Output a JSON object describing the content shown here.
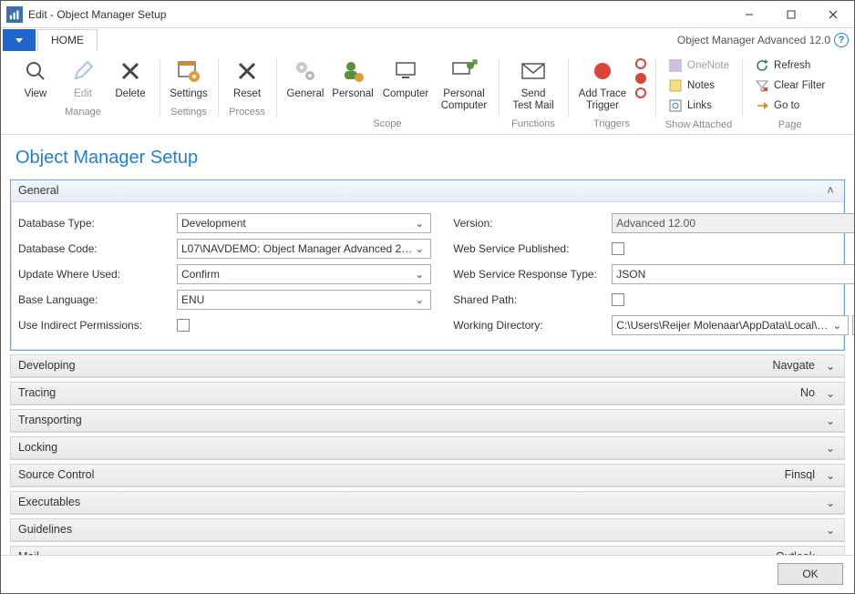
{
  "window": {
    "title": "Edit - Object Manager Setup"
  },
  "brand": "Object Manager Advanced 12.0",
  "tabs": {
    "home": "HOME"
  },
  "ribbon": {
    "manage": {
      "caption": "Manage",
      "view": "View",
      "edit": "Edit",
      "delete": "Delete"
    },
    "settings": {
      "caption": "Settings",
      "settings": "Settings"
    },
    "process": {
      "caption": "Process",
      "reset": "Reset"
    },
    "scope": {
      "caption": "Scope",
      "general": "General",
      "personal": "Personal",
      "computer": "Computer",
      "personal_computer": "Personal\nComputer"
    },
    "functions": {
      "caption": "Functions",
      "send_test_mail": "Send\nTest Mail"
    },
    "triggers": {
      "caption": "Triggers",
      "add_trace": "Add Trace\nTrigger"
    },
    "show_attached": {
      "caption": "Show Attached",
      "onenote": "OneNote",
      "notes": "Notes",
      "links": "Links"
    },
    "page": {
      "caption": "Page",
      "refresh": "Refresh",
      "clear_filter": "Clear Filter",
      "go_to": "Go to"
    }
  },
  "page_title": "Object Manager Setup",
  "panels": {
    "general": {
      "title": "General",
      "left": {
        "database_type": {
          "label": "Database Type:",
          "value": "Development"
        },
        "database_code": {
          "label": "Database Code:",
          "value": "L07\\NAVDEMO: Object Manager Advanced 2…"
        },
        "update_where_used": {
          "label": "Update Where Used:",
          "value": "Confirm"
        },
        "base_language": {
          "label": "Base Language:",
          "value": "ENU"
        },
        "use_indirect": {
          "label": "Use Indirect Permissions:"
        }
      },
      "right": {
        "version": {
          "label": "Version:",
          "value": "Advanced 12.00"
        },
        "web_published": {
          "label": "Web Service Published:"
        },
        "web_response": {
          "label": "Web Service Response Type:",
          "value": "JSON"
        },
        "shared_path": {
          "label": "Shared Path:"
        },
        "working_dir": {
          "label": "Working Directory:",
          "value": "C:\\Users\\Reijer Molenaar\\AppData\\Local\\…"
        }
      }
    },
    "collapsed": [
      {
        "title": "Developing",
        "value": "Navgate"
      },
      {
        "title": "Tracing",
        "value": "No"
      },
      {
        "title": "Transporting",
        "value": ""
      },
      {
        "title": "Locking",
        "value": ""
      },
      {
        "title": "Source Control",
        "value": "Finsql"
      },
      {
        "title": "Executables",
        "value": ""
      },
      {
        "title": "Guidelines",
        "value": ""
      },
      {
        "title": "Mail",
        "value": "Outlook"
      }
    ]
  },
  "footer": {
    "ok": "OK"
  }
}
